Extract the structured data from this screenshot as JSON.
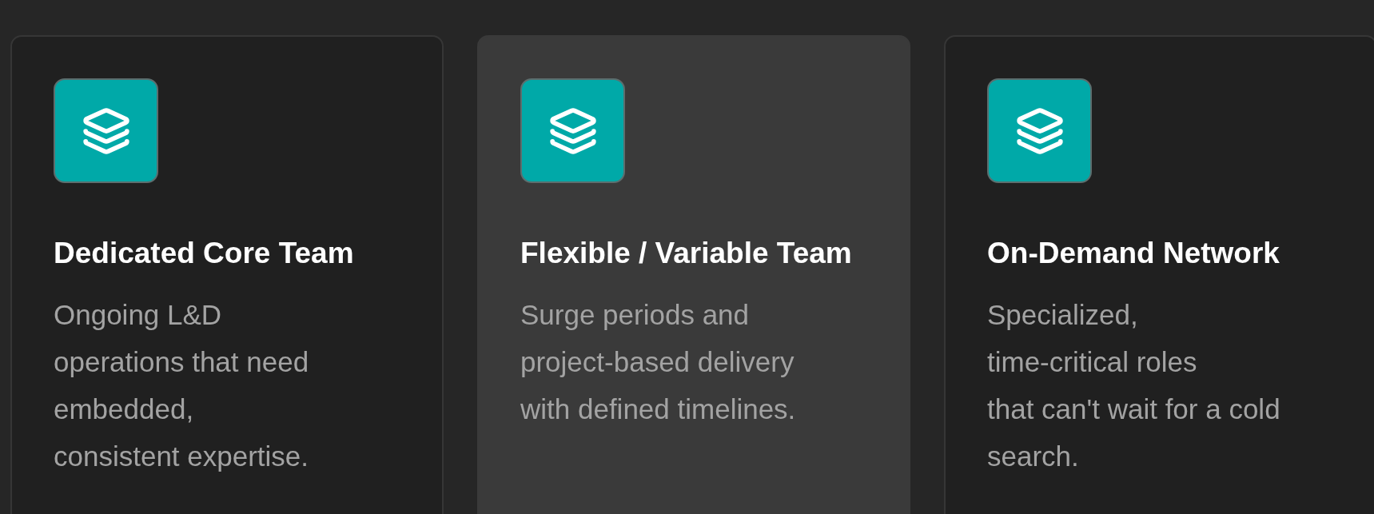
{
  "cards": [
    {
      "title": "Dedicated Core Team",
      "description_lines": [
        "Ongoing L&D",
        "operations that need",
        "embedded,",
        "consistent expertise."
      ],
      "selected": false
    },
    {
      "title": "Flexible / Variable Team",
      "description_lines": [
        "Surge periods and",
        "project-based delivery",
        "with defined timelines."
      ],
      "selected": true
    },
    {
      "title": "On-Demand Network",
      "description_lines": [
        "Specialized,",
        "time-critical roles",
        "that can't wait for a cold",
        "search."
      ],
      "selected": false
    }
  ]
}
